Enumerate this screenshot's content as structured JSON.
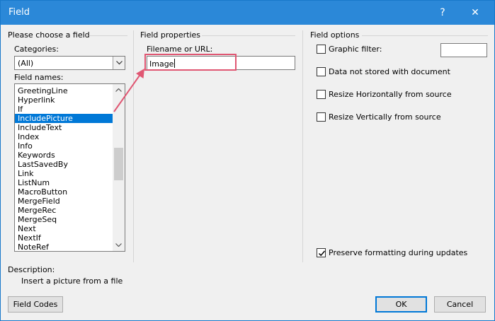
{
  "window": {
    "title": "Field",
    "help_glyph": "?",
    "close_glyph": "✕"
  },
  "left": {
    "group_title": "Please choose a field",
    "categories_label": "Categories:",
    "categories_value": "(All)",
    "field_names_label": "Field names:",
    "field_names": [
      "GreetingLine",
      "Hyperlink",
      "If",
      "IncludePicture",
      "IncludeText",
      "Index",
      "Info",
      "Keywords",
      "LastSavedBy",
      "Link",
      "ListNum",
      "MacroButton",
      "MergeField",
      "MergeRec",
      "MergeSeq",
      "Next",
      "NextIf",
      "NoteRef"
    ],
    "selected_field": "IncludePicture"
  },
  "middle": {
    "group_title": "Field properties",
    "filename_label": "Filename or URL:",
    "filename_value": "Image"
  },
  "right": {
    "group_title": "Field options",
    "options": [
      {
        "label": "Graphic filter:",
        "checked": false
      },
      {
        "label": "Data not stored with document",
        "checked": false
      },
      {
        "label": "Resize Horizontally from source",
        "checked": false
      },
      {
        "label": "Resize Vertically from source",
        "checked": false
      }
    ],
    "preserve_label": "Preserve formatting during updates",
    "preserve_checked": true
  },
  "description": {
    "label": "Description:",
    "text": "Insert a picture from a file"
  },
  "buttons": {
    "field_codes": "Field Codes",
    "ok": "OK",
    "cancel": "Cancel"
  },
  "colors": {
    "titlebar": "#2b88d8",
    "selection": "#0078d7",
    "annotation": "#e05773"
  }
}
